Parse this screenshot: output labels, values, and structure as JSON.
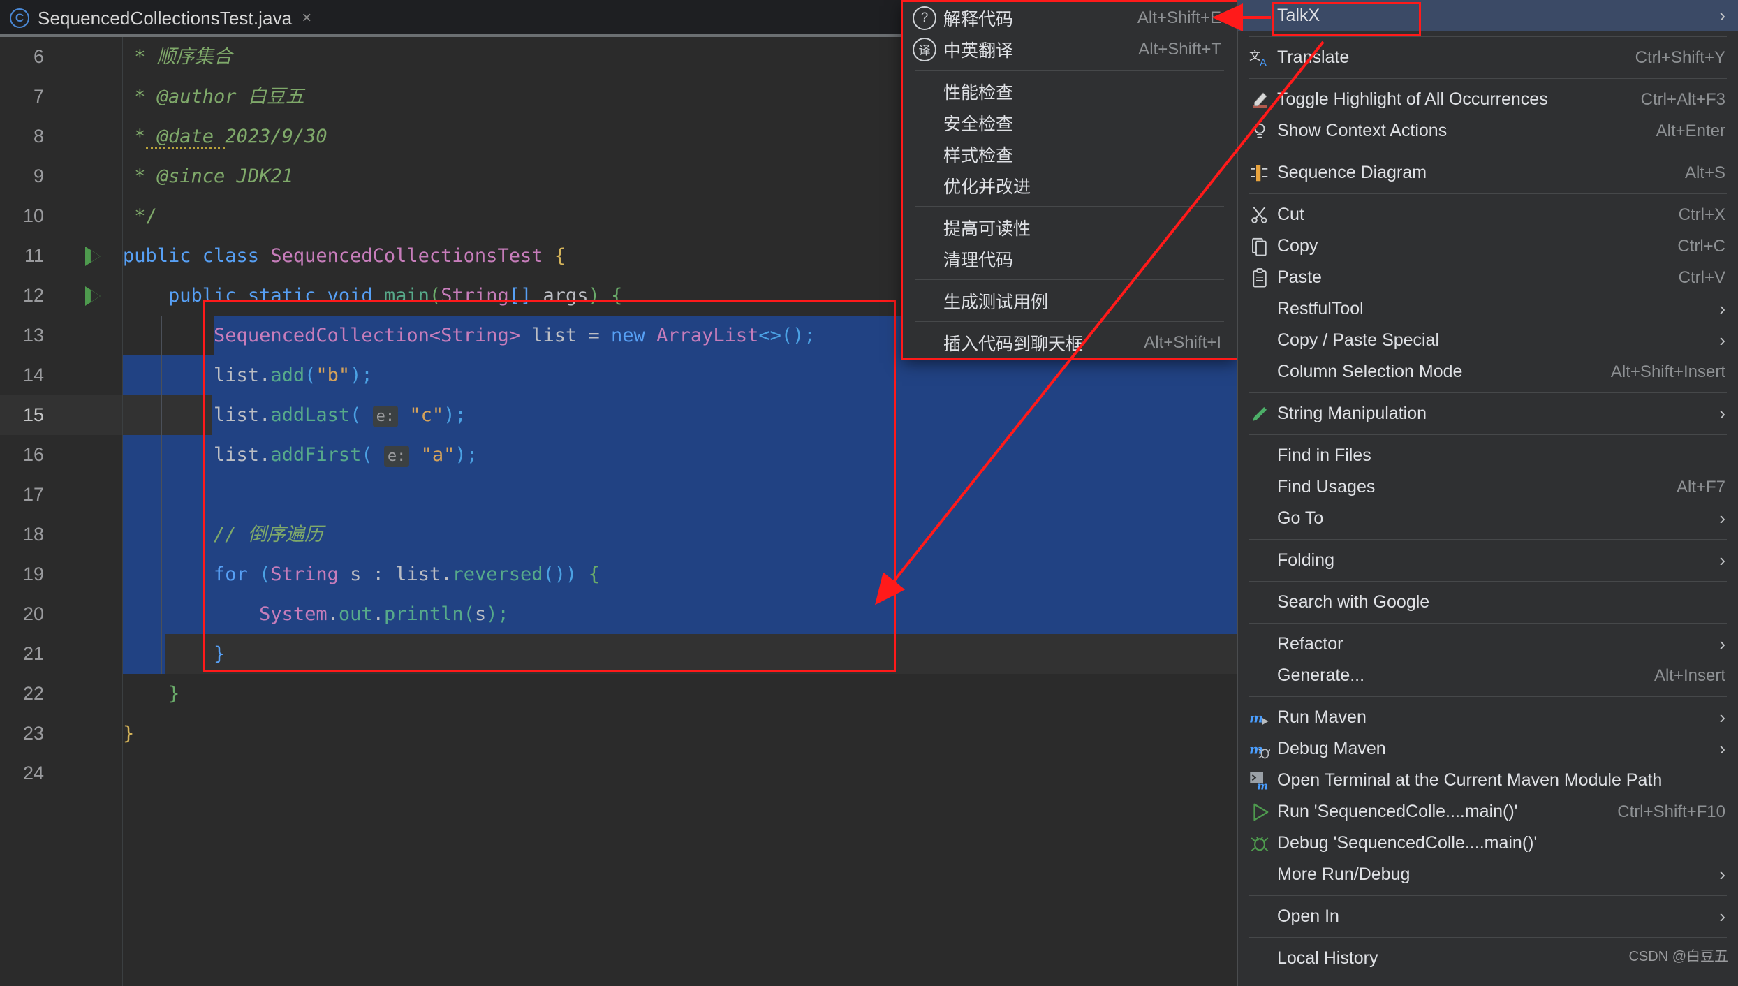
{
  "editor": {
    "tab": {
      "title": "SequencedCollectionsTest.java",
      "icon": "java-class-icon",
      "close": "×"
    },
    "first_line_number": 6,
    "current_line": 15,
    "lines": [
      {
        "n": 6,
        "run": false
      },
      {
        "n": 7,
        "run": false
      },
      {
        "n": 8,
        "run": false
      },
      {
        "n": 9,
        "run": false
      },
      {
        "n": 10,
        "run": false
      },
      {
        "n": 11,
        "run": true
      },
      {
        "n": 12,
        "run": true
      },
      {
        "n": 13,
        "run": false
      },
      {
        "n": 14,
        "run": false
      },
      {
        "n": 15,
        "run": false
      },
      {
        "n": 16,
        "run": false
      },
      {
        "n": 17,
        "run": false
      },
      {
        "n": 18,
        "run": false
      },
      {
        "n": 19,
        "run": false
      },
      {
        "n": 20,
        "run": false
      },
      {
        "n": 21,
        "run": false
      },
      {
        "n": 22,
        "run": false
      },
      {
        "n": 23,
        "run": false
      },
      {
        "n": 24,
        "run": false
      }
    ],
    "code_text": [
      " * 顺序集合",
      " * @author 白豆五",
      " * @date 2023/9/30",
      " * @since JDK21",
      " */",
      "public class SequencedCollectionsTest {",
      "    public static void main(String[] args) {",
      "        SequencedCollection<String> list = new ArrayList<>();",
      "        list.add(\"b\");",
      "        list.addLast( e: \"c\");",
      "        list.addFirst( e: \"a\");",
      "",
      "        // 倒序遍历",
      "        for (String s : list.reversed()) {",
      "            System.out.println(s);",
      "        }",
      "    }",
      "}",
      ""
    ],
    "param_hints": [
      "e:",
      "e:"
    ],
    "selection_note": "lines 13-21 selected"
  },
  "talkx_menu": {
    "items": [
      {
        "icon": "question-circle-icon",
        "label": "解释代码",
        "shortcut": "Alt+Shift+E",
        "sep_after": false
      },
      {
        "icon": "translate-circle-icon",
        "label": "中英翻译",
        "shortcut": "Alt+Shift+T",
        "sep_after": true
      },
      {
        "icon": "none",
        "label": "性能检查",
        "shortcut": "",
        "sep_after": false
      },
      {
        "icon": "none",
        "label": "安全检查",
        "shortcut": "",
        "sep_after": false
      },
      {
        "icon": "none",
        "label": "样式检查",
        "shortcut": "",
        "sep_after": false
      },
      {
        "icon": "none",
        "label": "优化并改进",
        "shortcut": "",
        "sep_after": true
      },
      {
        "icon": "none",
        "label": "提高可读性",
        "shortcut": "",
        "sep_after": false
      },
      {
        "icon": "none",
        "label": "清理代码",
        "shortcut": "",
        "sep_after": true
      },
      {
        "icon": "none",
        "label": "生成测试用例",
        "shortcut": "",
        "sep_after": true
      },
      {
        "icon": "none",
        "label": "插入代码到聊天框",
        "shortcut": "Alt+Shift+I",
        "sep_after": false
      }
    ],
    "icon_glyphs": {
      "question": "?",
      "translate": "译"
    }
  },
  "context_menu": {
    "items": [
      {
        "icon": "none",
        "label": "TalkX",
        "shortcut": "",
        "chevron": true,
        "selected": true,
        "sep_after": true
      },
      {
        "icon": "translate-icon",
        "label": "Translate",
        "shortcut": "Ctrl+Shift+Y",
        "chevron": false,
        "selected": false,
        "sep_after": true
      },
      {
        "icon": "highlight-pen-icon",
        "label": "Toggle Highlight of All Occurrences",
        "shortcut": "Ctrl+Alt+F3",
        "chevron": false,
        "selected": false,
        "sep_after": false
      },
      {
        "icon": "lightbulb-icon",
        "label": "Show Context Actions",
        "shortcut": "Alt+Enter",
        "chevron": false,
        "selected": false,
        "sep_after": true
      },
      {
        "icon": "sequence-diagram-icon",
        "label": "Sequence Diagram",
        "shortcut": "Alt+S",
        "chevron": false,
        "selected": false,
        "sep_after": true
      },
      {
        "icon": "scissors-icon",
        "label": "Cut",
        "shortcut": "Ctrl+X",
        "chevron": false,
        "selected": false,
        "sep_after": false
      },
      {
        "icon": "copy-icon",
        "label": "Copy",
        "shortcut": "Ctrl+C",
        "chevron": false,
        "selected": false,
        "sep_after": false
      },
      {
        "icon": "paste-icon",
        "label": "Paste",
        "shortcut": "Ctrl+V",
        "chevron": false,
        "selected": false,
        "sep_after": false
      },
      {
        "icon": "none",
        "label": "RestfulTool",
        "shortcut": "",
        "chevron": true,
        "selected": false,
        "sep_after": false
      },
      {
        "icon": "none",
        "label": "Copy / Paste Special",
        "shortcut": "",
        "chevron": true,
        "selected": false,
        "sep_after": false
      },
      {
        "icon": "none",
        "label": "Column Selection Mode",
        "shortcut": "Alt+Shift+Insert",
        "chevron": false,
        "selected": false,
        "sep_after": true
      },
      {
        "icon": "pencil-icon",
        "label": "String Manipulation",
        "shortcut": "",
        "chevron": true,
        "selected": false,
        "sep_after": true
      },
      {
        "icon": "none",
        "label": "Find in Files",
        "shortcut": "",
        "chevron": false,
        "selected": false,
        "sep_after": false
      },
      {
        "icon": "none",
        "label": "Find Usages",
        "shortcut": "Alt+F7",
        "chevron": false,
        "selected": false,
        "sep_after": false
      },
      {
        "icon": "none",
        "label": "Go To",
        "shortcut": "",
        "chevron": true,
        "selected": false,
        "sep_after": true
      },
      {
        "icon": "none",
        "label": "Folding",
        "shortcut": "",
        "chevron": true,
        "selected": false,
        "sep_after": true
      },
      {
        "icon": "none",
        "label": "Search with Google",
        "shortcut": "",
        "chevron": false,
        "selected": false,
        "sep_after": true
      },
      {
        "icon": "none",
        "label": "Refactor",
        "shortcut": "",
        "chevron": true,
        "selected": false,
        "sep_after": false
      },
      {
        "icon": "none",
        "label": "Generate...",
        "shortcut": "Alt+Insert",
        "chevron": false,
        "selected": false,
        "sep_after": true
      },
      {
        "icon": "maven-run-icon",
        "label": "Run Maven",
        "shortcut": "",
        "chevron": true,
        "selected": false,
        "sep_after": false
      },
      {
        "icon": "maven-debug-icon",
        "label": "Debug Maven",
        "shortcut": "",
        "chevron": true,
        "selected": false,
        "sep_after": false
      },
      {
        "icon": "terminal-icon",
        "label": "Open Terminal at the Current Maven Module Path",
        "shortcut": "",
        "chevron": false,
        "selected": false,
        "sep_after": false
      },
      {
        "icon": "run-icon",
        "label": "Run 'SequencedColle....main()'",
        "shortcut": "Ctrl+Shift+F10",
        "chevron": false,
        "selected": false,
        "sep_after": false
      },
      {
        "icon": "debug-icon",
        "label": "Debug 'SequencedColle....main()'",
        "shortcut": "",
        "chevron": false,
        "selected": false,
        "sep_after": false
      },
      {
        "icon": "none",
        "label": "More Run/Debug",
        "shortcut": "",
        "chevron": true,
        "selected": false,
        "sep_after": true
      },
      {
        "icon": "none",
        "label": "Open In",
        "shortcut": "",
        "chevron": true,
        "selected": false,
        "sep_after": true
      },
      {
        "icon": "none",
        "label": "Local History",
        "shortcut": "",
        "chevron": false,
        "selected": false,
        "sep_after": false
      }
    ]
  },
  "watermark": {
    "text": "CSDN @白豆五"
  },
  "colors": {
    "editor_bg": "#2b2b2b",
    "tab_bg": "#1e1f22",
    "menu_bg": "#2f3032",
    "selection_bg": "#214283",
    "menu_selected_bg": "#3b4a66",
    "annotation_red": "#ff1a1a",
    "comment_green": "#7fa96a",
    "keyword_orange": "#cf8e6d",
    "type_purple": "#c77dbb",
    "method_green": "#57aa8a",
    "string_orange": "#d5a25a"
  }
}
